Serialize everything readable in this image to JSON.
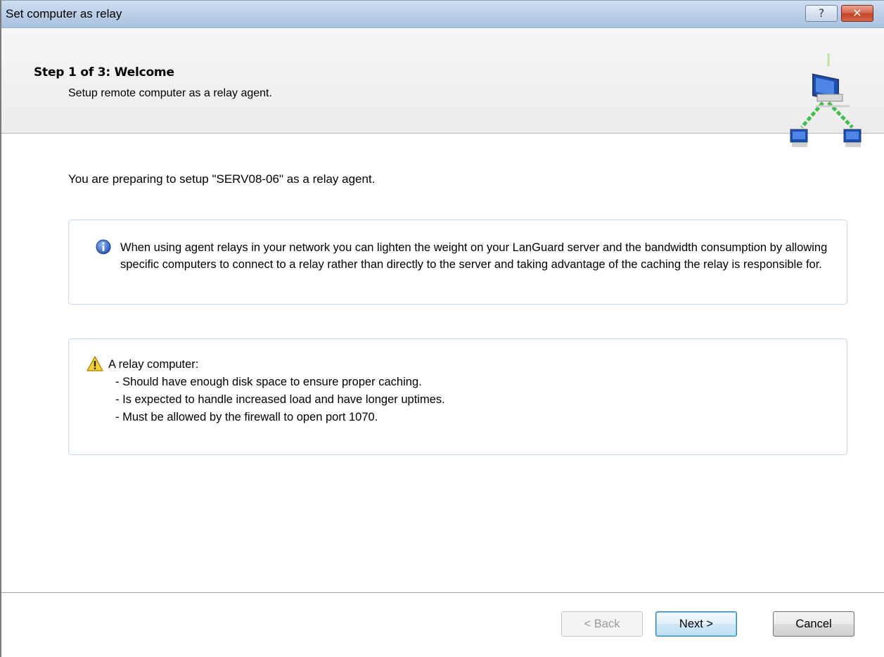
{
  "window": {
    "title": "Set computer as relay",
    "help_label": "?",
    "close_label": "✕"
  },
  "header": {
    "step_title": "Step 1 of 3: Welcome",
    "step_subtitle": "Setup remote computer as a relay agent.",
    "icon": "network-relay-icon"
  },
  "main": {
    "intro": "You are preparing to setup \"SERV08-06\" as a relay agent.",
    "info_box": {
      "icon": "info-icon",
      "text": "When using agent relays in your network you can lighten the weight on your LanGuard server and the bandwidth consumption by allowing specific computers to connect to a relay rather than directly to the server and taking advantage of the caching the relay is responsible for."
    },
    "warning_box": {
      "icon": "warning-icon",
      "lines": [
        "A relay computer:",
        "- Should have enough disk space to ensure proper caching.",
        "- Is expected to handle increased load and have longer uptimes.",
        "- Must be allowed by the firewall to open port 1070."
      ]
    }
  },
  "footer": {
    "back_label": "< Back",
    "next_label": "Next >",
    "cancel_label": "Cancel"
  }
}
